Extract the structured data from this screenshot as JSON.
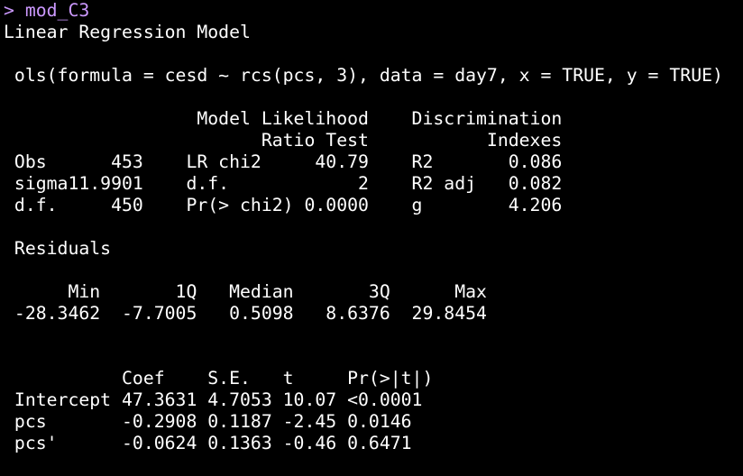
{
  "colors": {
    "background": "#000000",
    "output_text": "#ffffff",
    "command_text": "#cc99ff"
  },
  "console": {
    "lines": [
      "> mod_C3",
      "Linear Regression Model",
      "",
      " ols(formula = cesd ~ rcs(pcs, 3), data = day7, x = TRUE, y = TRUE)",
      "",
      "                  Model Likelihood    Discrimination",
      "                        Ratio Test           Indexes",
      " Obs      453    LR chi2     40.79    R2       0.086",
      " sigma11.9901    d.f.            2    R2 adj   0.082",
      " d.f.     450    Pr(> chi2) 0.0000    g        4.206",
      "",
      " Residuals",
      "",
      "      Min       1Q   Median       3Q      Max",
      " -28.3462  -7.7005   0.5098   8.6376  29.8454",
      "",
      "",
      "           Coef    S.E.   t     Pr(>|t|)",
      " Intercept 47.3631 4.7053 10.07 <0.0001",
      " pcs       -0.2908 0.1187 -2.45 0.0146",
      " pcs'      -0.0624 0.1363 -0.46 0.6471",
      ""
    ]
  }
}
